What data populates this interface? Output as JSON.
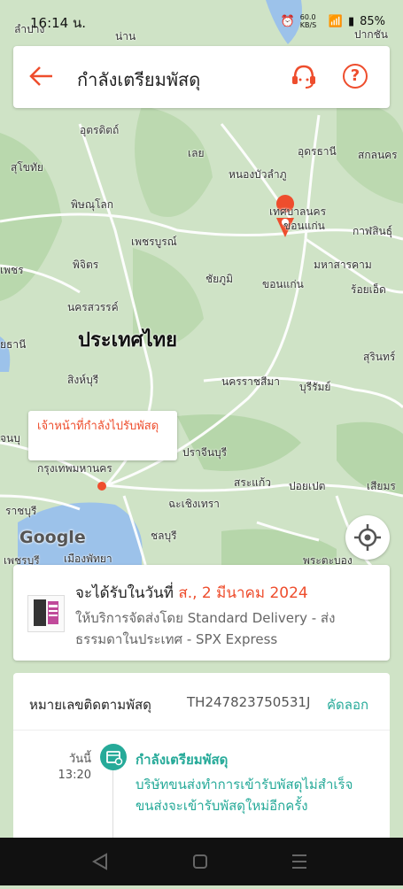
{
  "status_bar": {
    "time": "16:14 น.",
    "data_speed": "60.0 KB/S",
    "battery": "85%"
  },
  "header": {
    "title": "กำลังเตรียมพัสดุ"
  },
  "map": {
    "labels": [
      {
        "text": "ลำปาง"
      },
      {
        "text": "น่าน"
      },
      {
        "text": "ปากชัน"
      },
      {
        "text": "อุตรดิตถ์"
      },
      {
        "text": "อุดรธานี"
      },
      {
        "text": "สกลนคร"
      },
      {
        "text": "สุโขทัย"
      },
      {
        "text": "เลย"
      },
      {
        "text": "หนองบัวลำภู"
      },
      {
        "text": "พิษณุโลก"
      },
      {
        "text": "เทศบาลนคร"
      },
      {
        "text": "ขอนแก่น"
      },
      {
        "text": "กาฬสินธุ์"
      },
      {
        "text": "เพชรบูรณ์"
      },
      {
        "text": "มหาสารคาม"
      },
      {
        "text": "เพชร"
      },
      {
        "text": "พิจิตร"
      },
      {
        "text": "ชัยภูมิ"
      },
      {
        "text": "ขอนแก่น"
      },
      {
        "text": "ร้อยเอ็ด"
      },
      {
        "text": "นครสวรรค์"
      },
      {
        "text": "ประเทศไทย"
      },
      {
        "text": "ยธานี"
      },
      {
        "text": "สุรินทร์"
      },
      {
        "text": "สิงห์บุรี"
      },
      {
        "text": "นครราชสีมา"
      },
      {
        "text": "บุรีรัมย์"
      },
      {
        "text": "จนบุ"
      },
      {
        "text": "ปราจีนบุรี"
      },
      {
        "text": "กรุงเทพมหานคร"
      },
      {
        "text": "สระแก้ว"
      },
      {
        "text": "ปอยเปต"
      },
      {
        "text": "เสียมร"
      },
      {
        "text": "ราชบุรี"
      },
      {
        "text": "ฉะเชิงเทรา"
      },
      {
        "text": "ชลบุรี"
      },
      {
        "text": "เพชรบุรี"
      },
      {
        "text": "เมืองพัทยา"
      },
      {
        "text": "พระตะบอง"
      }
    ],
    "courier_tooltip": "เจ้าหน้าที่กำลังไปรับพัสดุ",
    "google_logo": "Google"
  },
  "delivery_card": {
    "eta_prefix": "จะได้รับในวันที่",
    "eta_date": "ส., 2 มีนาคม 2024",
    "service": "ให้บริการจัดส่งโดย Standard Delivery - ส่งธรรมดาในประเทศ - SPX Express"
  },
  "tracking": {
    "label": "หมายเลขติดตามพัสดุ",
    "number": "TH247823750531J",
    "copy_label": "คัดลอก",
    "events": [
      {
        "day": "วันนี้",
        "time": "13:20",
        "title": "กำลังเตรียมพัสดุ",
        "description": "บริษัทขนส่งทำการเข้ารับพัสดุไม่สำเร็จ ขนส่งจะเข้ารับพัสดุใหม่อีกครั้ง"
      }
    ]
  },
  "colors": {
    "accent": "#ee4d2d",
    "teal": "#26aa99",
    "map_land": "#cfe3c6",
    "map_water": "#9cc2ea"
  }
}
